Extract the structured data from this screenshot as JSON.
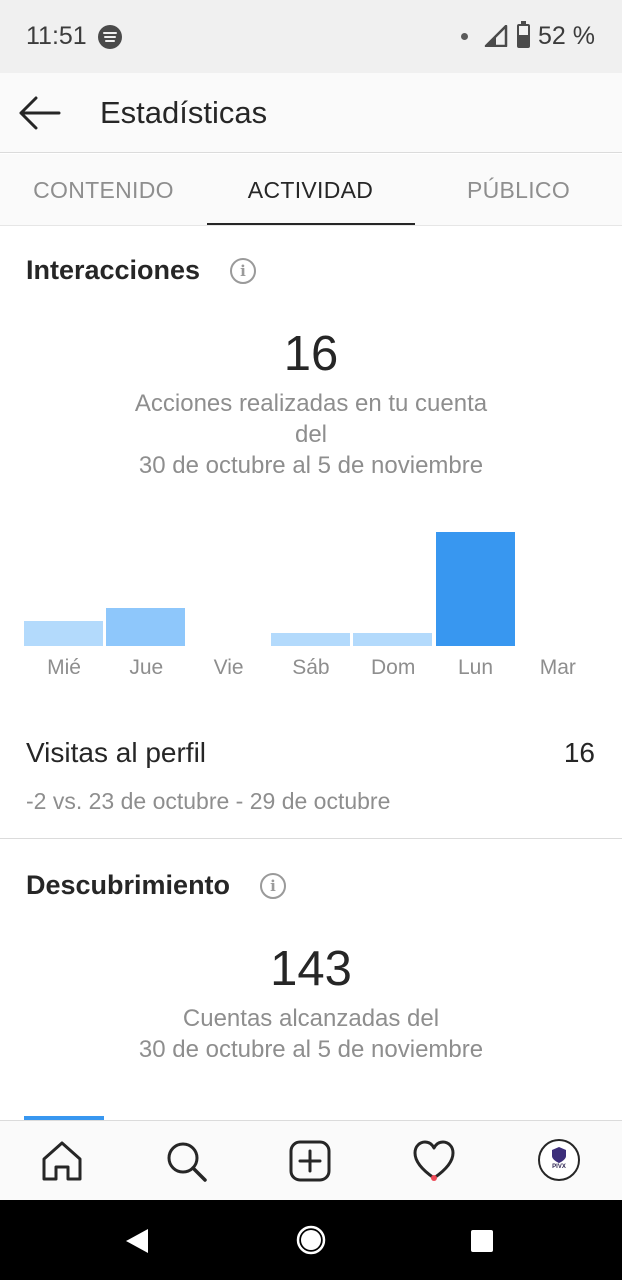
{
  "status_bar": {
    "time": "11:51",
    "battery": "52 %",
    "icons": [
      "spotify-icon",
      "signal-icon",
      "battery-icon"
    ]
  },
  "header": {
    "title": "Estadísticas",
    "back_icon": "arrow-left-icon"
  },
  "tabs": [
    {
      "label": "CONTENIDO",
      "active": false
    },
    {
      "label": "ACTIVIDAD",
      "active": true
    },
    {
      "label": "PÚBLICO",
      "active": false
    }
  ],
  "interactions": {
    "title": "Interacciones",
    "value": "16",
    "caption_line1": "Acciones realizadas en tu cuenta",
    "caption_line2": "del",
    "caption_line3": "30 de octubre al 5 de noviembre"
  },
  "chart_data": {
    "type": "bar",
    "categories": [
      "Mié",
      "Jue",
      "Vie",
      "Sáb",
      "Dom",
      "Lun",
      "Mar"
    ],
    "values": [
      2,
      3,
      0,
      1,
      1,
      9,
      0
    ],
    "highlighted_category": "Lun",
    "colors": {
      "bar": "#b3dafc",
      "bar_mid": "#8ec7fb",
      "highlight": "#3897f0"
    }
  },
  "profile_visits": {
    "label": "Visitas al perfil",
    "value": "16",
    "comparison": "-2 vs. 23 de octubre - 29 de octubre"
  },
  "discovery": {
    "title": "Descubrimiento",
    "value": "143",
    "caption_line1": "Cuentas alcanzadas del",
    "caption_line2": "30 de octubre al 5 de noviembre"
  },
  "bottom_nav": {
    "items": [
      "home-icon",
      "search-icon",
      "add-post-icon",
      "activity-heart-icon",
      "profile-avatar"
    ],
    "avatar_text": "PIVX"
  },
  "colors": {
    "accent": "#3897f0",
    "notification": "#ed4956",
    "text_primary": "#262626",
    "text_secondary": "#8e8e8e"
  }
}
